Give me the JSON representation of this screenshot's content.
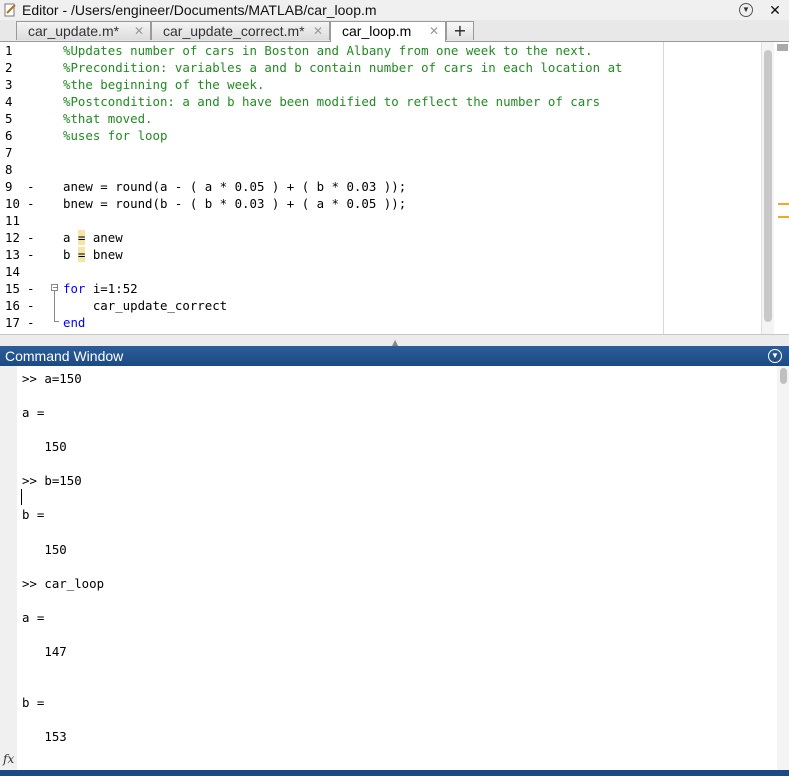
{
  "editor": {
    "title": "Editor - /Users/engineer/Documents/MATLAB/car_loop.m",
    "tabs": [
      {
        "label": "car_update.m*",
        "active": false
      },
      {
        "label": "car_update_correct.m*",
        "active": false
      },
      {
        "label": "car_loop.m",
        "active": true
      }
    ],
    "add_tab_label": "+",
    "close_glyph": "✕",
    "lines": [
      {
        "num": "1",
        "dash": "",
        "text": "%Updates number of cars in Boston and Albany from one week to the next."
      },
      {
        "num": "2",
        "dash": "",
        "text": "%Precondition: variables a and b contain number of cars in each location at"
      },
      {
        "num": "3",
        "dash": "",
        "text": "%the beginning of the week."
      },
      {
        "num": "4",
        "dash": "",
        "text": "%Postcondition: a and b have been modified to reflect the number of cars"
      },
      {
        "num": "5",
        "dash": "",
        "text": "%that moved."
      },
      {
        "num": "6",
        "dash": "",
        "text": "%uses for loop"
      },
      {
        "num": "7",
        "dash": "",
        "text": ""
      },
      {
        "num": "8",
        "dash": "",
        "text": ""
      },
      {
        "num": "9",
        "dash": "-",
        "text": "anew = round(a - ( a * 0.05 ) + ( b * 0.03 ));"
      },
      {
        "num": "10",
        "dash": "-",
        "text": "bnew = round(b - ( b * 0.03 ) + ( a * 0.05 ));"
      },
      {
        "num": "11",
        "dash": "",
        "text": ""
      },
      {
        "num": "12",
        "dash": "-",
        "pre": "a ",
        "hl": "=",
        "post": " anew"
      },
      {
        "num": "13",
        "dash": "-",
        "pre": "b ",
        "hl": "=",
        "post": " bnew"
      },
      {
        "num": "14",
        "dash": "",
        "text": ""
      },
      {
        "num": "15",
        "dash": "-",
        "kw": "for",
        "post": " i=1:52"
      },
      {
        "num": "16",
        "dash": "-",
        "text": "    car_update_correct"
      },
      {
        "num": "17",
        "dash": "-",
        "kw": "end"
      }
    ]
  },
  "command_window": {
    "title": "Command Window",
    "lines": [
      ">> a=150",
      "",
      "a =",
      "",
      "   150",
      "",
      ">> b=150",
      "",
      "b =",
      "",
      "   150",
      "",
      ">> car_loop",
      "",
      "a =",
      "",
      "   147",
      "",
      "",
      "b =",
      "",
      "   153"
    ],
    "fx_label": "fx"
  }
}
